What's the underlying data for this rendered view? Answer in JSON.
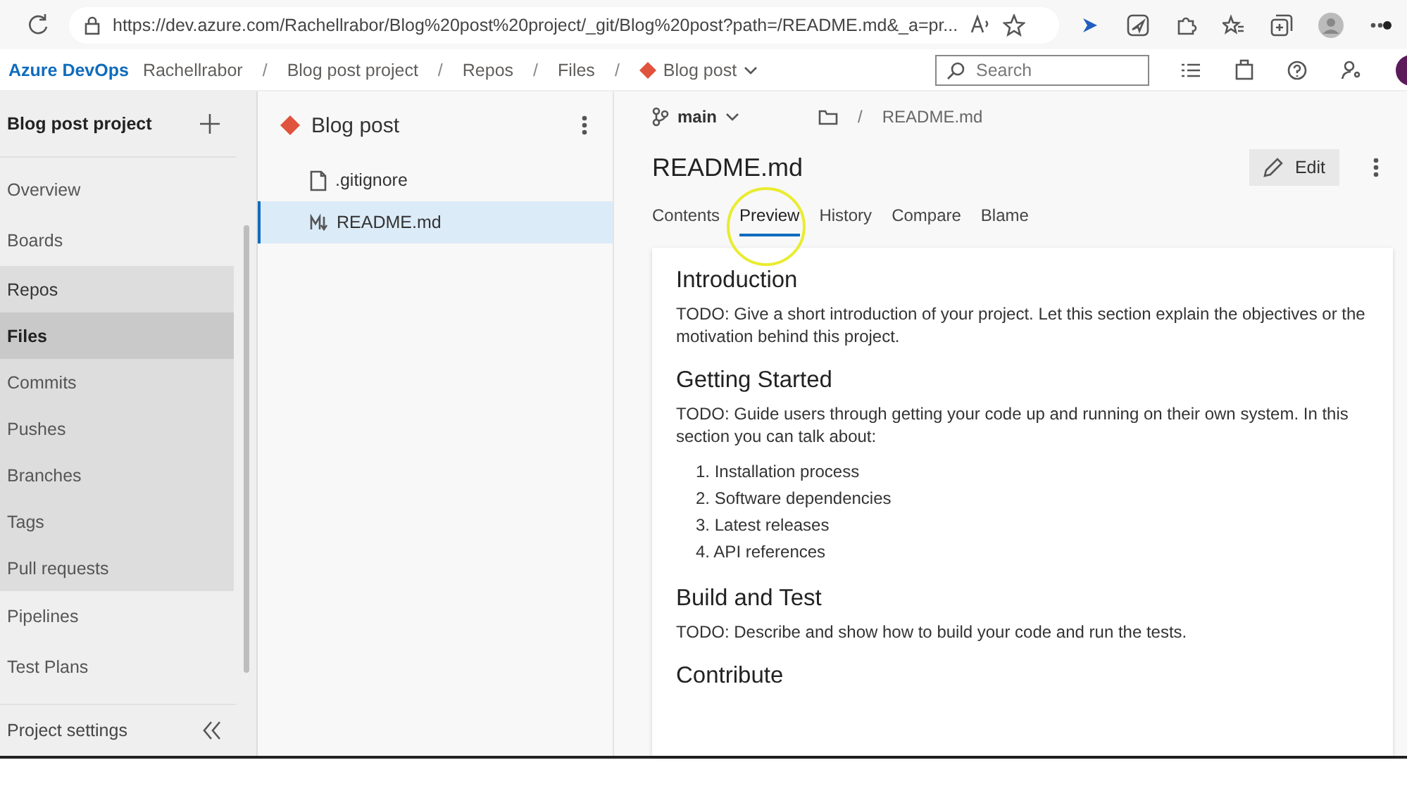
{
  "browser": {
    "url": "https://dev.azure.com/Rachellrabor/Blog%20post%20project/_git/Blog%20post?path=/README.md&_a=pr..."
  },
  "header": {
    "brand": "Azure DevOps",
    "breadcrumbs": [
      {
        "label": "Rachellrabor",
        "kind": "text"
      },
      {
        "separator": "/",
        "label": "Blog post project",
        "kind": "text"
      },
      {
        "separator": "/",
        "label": "Repos",
        "kind": "text"
      },
      {
        "separator": "/",
        "label": "Files",
        "kind": "text"
      },
      {
        "separator": "/",
        "label": "Blog post",
        "kind": "repo"
      }
    ],
    "search": {
      "placeholder": "Search"
    }
  },
  "sidebar": {
    "project": "Blog post project",
    "items": [
      {
        "label": "Overview",
        "expanded": false,
        "selected": false
      },
      {
        "label": "Boards",
        "expanded": false,
        "selected": false
      },
      {
        "label": "Repos",
        "expanded": true,
        "selected": false,
        "children": [
          {
            "label": "Files",
            "selected": true
          },
          {
            "label": "Commits",
            "selected": false
          },
          {
            "label": "Pushes",
            "selected": false
          },
          {
            "label": "Branches",
            "selected": false
          },
          {
            "label": "Tags",
            "selected": false
          },
          {
            "label": "Pull requests",
            "selected": false
          }
        ]
      },
      {
        "label": "Pipelines",
        "expanded": false,
        "selected": false
      },
      {
        "label": "Test Plans",
        "expanded": false,
        "selected": false
      }
    ],
    "footer": "Project settings"
  },
  "file_tree": {
    "repo": "Blog post",
    "files": [
      {
        "name": ".gitignore",
        "kind": "file",
        "selected": false
      },
      {
        "name": "README.md",
        "kind": "markdown",
        "selected": true
      }
    ]
  },
  "file_view": {
    "branch": "main",
    "path_separator": "/",
    "path": "README.md",
    "title": "README.md",
    "edit": "Edit",
    "tabs": [
      {
        "label": "Contents",
        "selected": false
      },
      {
        "label": "Preview",
        "selected": true
      },
      {
        "label": "History",
        "selected": false
      },
      {
        "label": "Compare",
        "selected": false
      },
      {
        "label": "Blame",
        "selected": false
      }
    ],
    "sections": [
      {
        "heading": "Introduction",
        "text": "TODO: Give a short introduction of your project. Let this section explain the objectives or the motivation behind this project."
      },
      {
        "heading": "Getting Started",
        "text": "TODO: Guide users through getting your code up and running on their own system. In this section you can talk about:",
        "list": [
          "1. Installation process",
          "2. Software dependencies",
          "3. Latest releases",
          "4. API references"
        ]
      },
      {
        "heading": "Build and Test",
        "text": "TODO: Describe and show how to build your code and run the tests."
      },
      {
        "heading": "Contribute"
      }
    ]
  }
}
